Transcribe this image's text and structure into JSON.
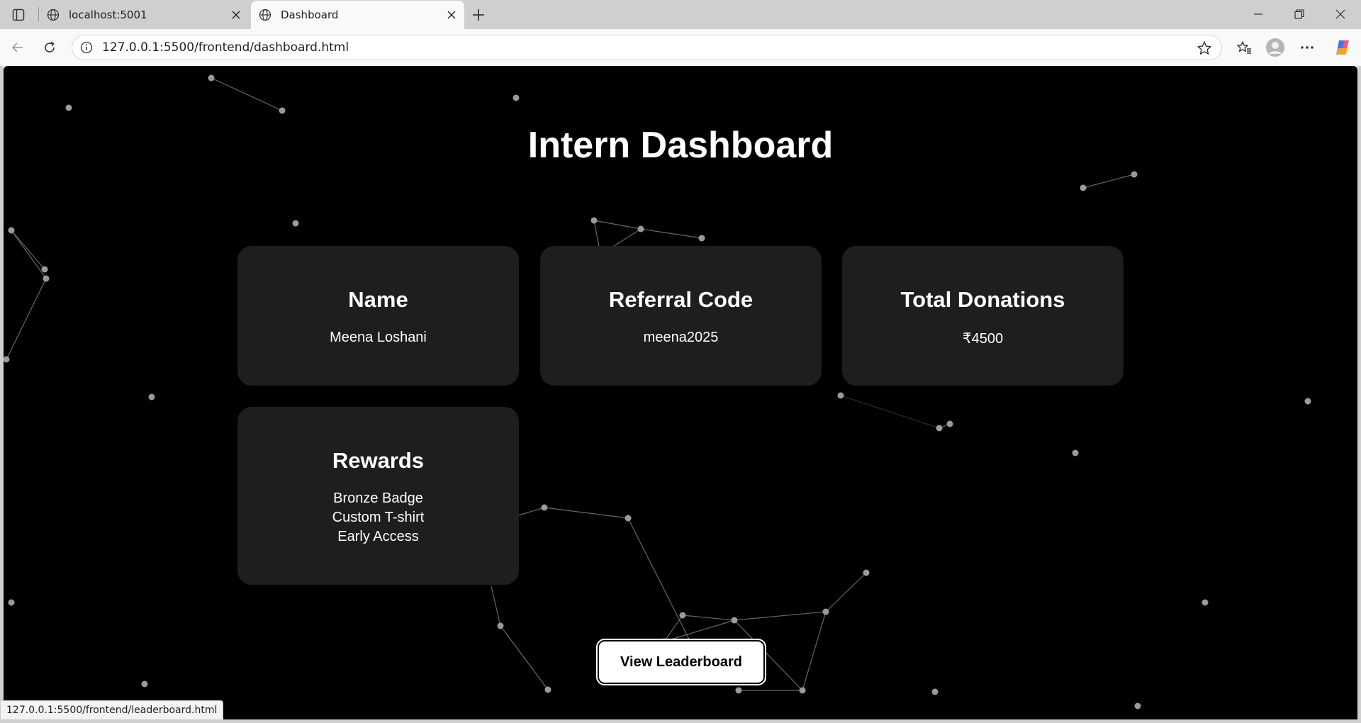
{
  "browser": {
    "tabs": [
      {
        "title": "localhost:5001",
        "active": false
      },
      {
        "title": "Dashboard",
        "active": true
      }
    ],
    "url": "127.0.0.1:5500/frontend/dashboard.html",
    "status_url": "127.0.0.1:5500/frontend/leaderboard.html",
    "icons": {
      "tab_actions": "tab-actions-icon",
      "favicon": "globe-icon",
      "new_tab": "plus-icon",
      "back": "arrow-left-icon",
      "reload": "reload-icon",
      "site_info": "info-icon",
      "favorite": "star-icon",
      "favorites": "favorites-icon",
      "profile": "avatar-icon",
      "menu": "more-icon",
      "copilot": "copilot-icon"
    }
  },
  "page": {
    "title": "Intern Dashboard",
    "cards": {
      "name": {
        "heading": "Name",
        "value": "Meena Loshani"
      },
      "referral": {
        "heading": "Referral Code",
        "value": "meena2025"
      },
      "donations": {
        "heading": "Total Donations",
        "value": "₹4500"
      },
      "rewards": {
        "heading": "Rewards",
        "items": [
          "Bronze Badge",
          "Custom T-shirt",
          "Early Access"
        ]
      }
    },
    "leaderboard_button": "View Leaderboard"
  },
  "colors": {
    "background": "#000000",
    "card": "#202020",
    "text": "#ffffff",
    "particle": "#9a9a9a",
    "chrome": "#cfcfcf"
  }
}
